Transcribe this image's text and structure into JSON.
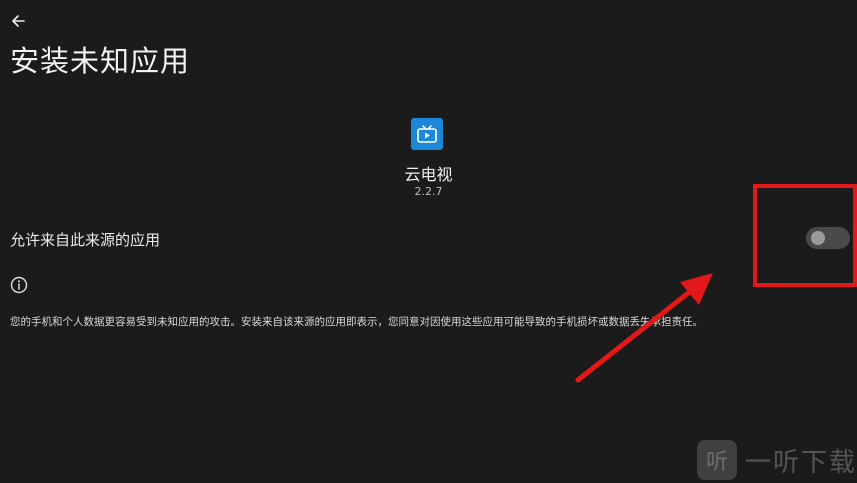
{
  "header": {
    "back_icon": "arrow-back-icon",
    "title": "安装未知应用"
  },
  "app": {
    "icon": "tv-play-icon",
    "icon_color": "#1e88d8",
    "name": "云电视",
    "version": "2.2.7"
  },
  "setting": {
    "label": "允许来自此来源的应用",
    "toggle_state": "off"
  },
  "info": {
    "icon": "info-icon",
    "warning": "您的手机和个人数据更容易受到未知应用的攻击。安装来自该来源的应用即表示，您同意对因使用这些应用可能导致的手机损坏或数据丢失承担责任。"
  },
  "annotation": {
    "highlight_color": "#e31818"
  },
  "watermark": {
    "logo_glyph": "听",
    "text": "一听下载"
  }
}
